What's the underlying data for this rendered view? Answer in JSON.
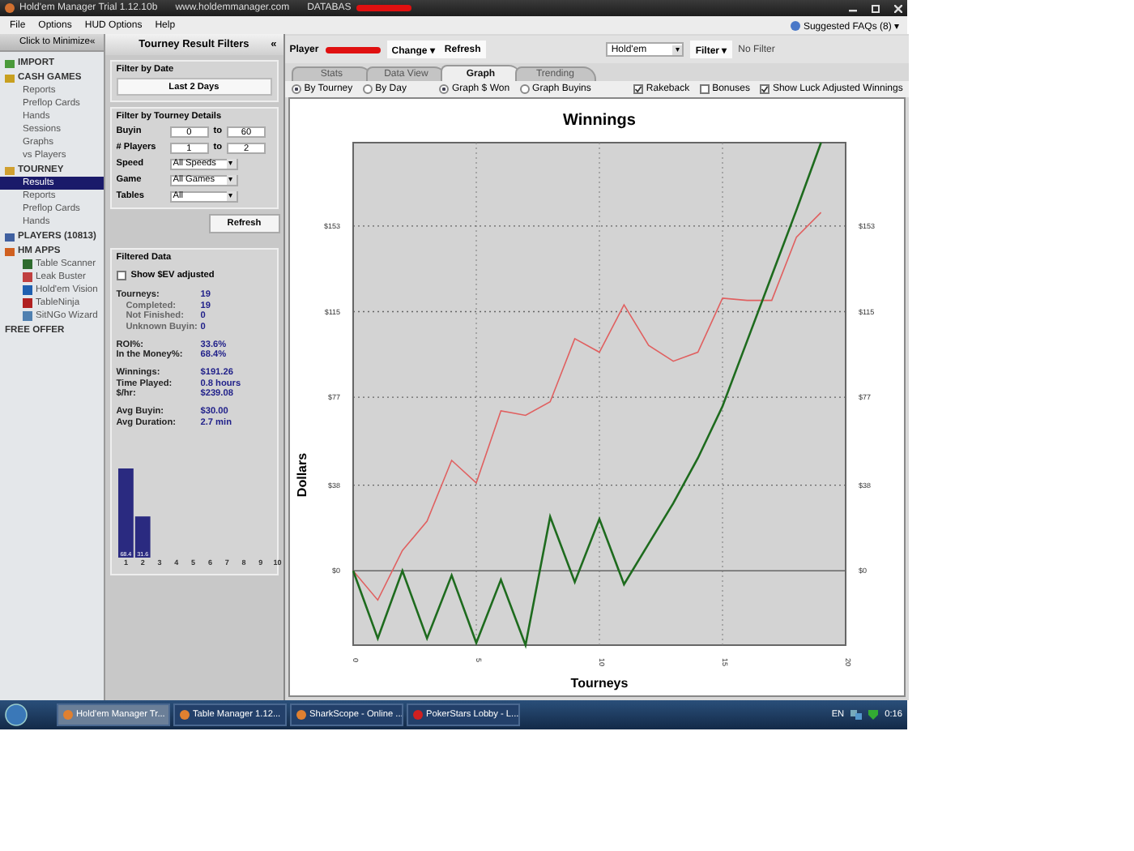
{
  "window": {
    "title": "Hold'em Manager Trial 1.12.10b",
    "url": "www.holdemmanager.com",
    "database_label": "DATABAS"
  },
  "menu": [
    "File",
    "Options",
    "HUD Options",
    "Help"
  ],
  "faqs": "Suggested FAQs (8)",
  "faqs_caret": "▾",
  "sidebar": {
    "minimize": "Click to Minimize",
    "collapse": "«",
    "items": [
      {
        "label": "IMPORT",
        "selected": false
      },
      {
        "label": "CASH GAMES",
        "selected": false,
        "children": [
          {
            "label": "Reports",
            "selected": false
          },
          {
            "label": "Preflop Cards",
            "selected": false
          },
          {
            "label": "Hands",
            "selected": false
          },
          {
            "label": "Sessions",
            "selected": false
          },
          {
            "label": "Graphs",
            "selected": false
          },
          {
            "label": "vs Players",
            "selected": false
          }
        ]
      },
      {
        "label": "TOURNEY",
        "selected": false,
        "children": [
          {
            "label": "Results",
            "selected": true
          },
          {
            "label": "Reports",
            "selected": false
          },
          {
            "label": "Preflop Cards",
            "selected": false
          },
          {
            "label": "Hands",
            "selected": false
          }
        ]
      },
      {
        "label": "PLAYERS (10813)",
        "selected": false
      },
      {
        "label": "HM APPS",
        "selected": false,
        "children": [
          {
            "label": "Table Scanner",
            "selected": false,
            "color": "#2e6b2e"
          },
          {
            "label": "Leak Buster",
            "selected": false,
            "color": "#c04040"
          },
          {
            "label": "Hold'em Vision",
            "selected": false,
            "color": "#2060b0"
          },
          {
            "label": "TableNinja",
            "selected": false,
            "color": "#b02020"
          },
          {
            "label": "SitNGo Wizard",
            "selected": false,
            "color": "#5080b0"
          }
        ]
      },
      {
        "label": "FREE OFFER",
        "selected": false
      }
    ]
  },
  "filters": {
    "title": "Tourney Result Filters",
    "collapse": "«",
    "date_group": {
      "title": "Filter by Date",
      "button": "Last 2 Days"
    },
    "details_group": {
      "title": "Filter by Tourney Details",
      "ranges": [
        {
          "label": "Buyin",
          "from": "0",
          "sep": "to",
          "to": "60"
        },
        {
          "label": "# Players",
          "from": "1",
          "sep": "to",
          "to": "2"
        }
      ],
      "selects": [
        {
          "label": "Speed",
          "value": "All Speeds",
          "caret": "▾"
        },
        {
          "label": "Game",
          "value": "All Games",
          "caret": "▾"
        },
        {
          "label": "Tables",
          "value": "All",
          "caret": "▾"
        }
      ]
    },
    "refresh": "Refresh",
    "filtered": {
      "title": "Filtered Data",
      "ev_checkbox": {
        "label": "Show $EV adjusted",
        "checked": false
      },
      "groups": [
        [
          {
            "label": "Tourneys:",
            "value": "19",
            "kind": "main"
          },
          {
            "label": "Completed:",
            "value": "19",
            "kind": "sub"
          },
          {
            "label": "Not Finished:",
            "value": "0",
            "kind": "sub"
          },
          {
            "label": "Unknown Buyin:",
            "value": "0",
            "kind": "sub"
          }
        ],
        [
          {
            "label": "ROI%:",
            "value": "33.6%",
            "kind": "main"
          },
          {
            "label": "In the Money%:",
            "value": "68.4%",
            "kind": "main"
          }
        ],
        [
          {
            "label": "Winnings:",
            "value": "$191.26",
            "kind": "main"
          },
          {
            "label": "Time Played:",
            "value": "0.8 hours",
            "kind": "main"
          },
          {
            "label": "$/hr:",
            "value": "$239.08",
            "kind": "main"
          }
        ],
        [
          {
            "label": "Avg Buyin:",
            "value": "$30.00",
            "kind": "main"
          },
          {
            "label": "Avg Duration:",
            "value": "2.7 min",
            "kind": "main"
          }
        ]
      ],
      "chart_data": {
        "type": "bar",
        "categories": [
          "1",
          "2",
          "3",
          "4",
          "5",
          "6",
          "7",
          "8",
          "9",
          "10"
        ],
        "values": [
          68.4,
          31.6,
          0,
          0,
          0,
          0,
          0,
          0,
          0,
          0
        ],
        "value_labels": [
          "68.4",
          "31.6",
          null,
          null,
          null,
          null,
          null,
          null,
          null,
          null
        ]
      }
    }
  },
  "toolbar": {
    "player_label": "Player",
    "change": "Change",
    "change_caret": "▾",
    "refresh": "Refresh",
    "game": "Hold'em",
    "game_caret": "▾",
    "filter": "Filter",
    "filter_caret": "▾",
    "filter_status": "No Filter"
  },
  "tabs": [
    {
      "label": "Stats",
      "selected": false
    },
    {
      "label": "Data View",
      "selected": false
    },
    {
      "label": "Graph",
      "selected": true
    },
    {
      "label": "Trending",
      "selected": false
    }
  ],
  "options": [
    {
      "kind": "radio",
      "label": "By Tourney",
      "selected": true
    },
    {
      "kind": "radio",
      "label": "By Day",
      "selected": false
    },
    {
      "kind": "radio",
      "label": "Graph $ Won",
      "selected": true
    },
    {
      "kind": "radio",
      "label": "Graph Buyins",
      "selected": false
    },
    {
      "kind": "checkbox",
      "label": "Rakeback",
      "checked": true
    },
    {
      "kind": "checkbox",
      "label": "Bonuses",
      "checked": false
    },
    {
      "kind": "checkbox",
      "label": "Show Luck Adjusted Winnings",
      "checked": true
    }
  ],
  "graph": {
    "chart_data": {
      "type": "line",
      "title": "Winnings",
      "xlabel": "Tourneys",
      "ylabel": "Dollars",
      "x": [
        0,
        1,
        2,
        3,
        4,
        5,
        6,
        7,
        8,
        9,
        10,
        11,
        12,
        13,
        14,
        15,
        16,
        17,
        18,
        19
      ],
      "series": [
        {
          "color": "#e06060",
          "values": [
            0,
            -13,
            9,
            22,
            49,
            39,
            71,
            69,
            75,
            103,
            97,
            118,
            100,
            93,
            97,
            121,
            120,
            120,
            148,
            159
          ]
        },
        {
          "color": "#1e6b1e",
          "values": [
            0,
            -30,
            0,
            -30,
            -2,
            -32,
            -4,
            -33,
            24,
            -5,
            23,
            -6,
            12,
            30,
            50,
            73,
            102,
            131,
            160,
            190
          ]
        }
      ],
      "xlim": [
        0,
        20
      ],
      "ylim": [
        -33,
        190
      ],
      "grid": true,
      "xticks": [
        0,
        5,
        10,
        15,
        20
      ],
      "yticks": [
        {
          "value": 0,
          "label": "$0"
        },
        {
          "value": 38,
          "label": "$38"
        },
        {
          "value": 77,
          "label": "$77"
        },
        {
          "value": 115,
          "label": "$115"
        },
        {
          "value": 153,
          "label": "$153"
        }
      ]
    }
  },
  "taskbar": {
    "tasks": [
      {
        "label": "Hold'em Manager Tr...",
        "selected": true
      },
      {
        "label": "Table Manager 1.12...",
        "selected": false
      },
      {
        "label": "SharkScope - Online ...",
        "selected": false
      },
      {
        "label": "PokerStars Lobby - L...",
        "selected": false
      }
    ],
    "language": "EN",
    "clock": "0:16"
  }
}
